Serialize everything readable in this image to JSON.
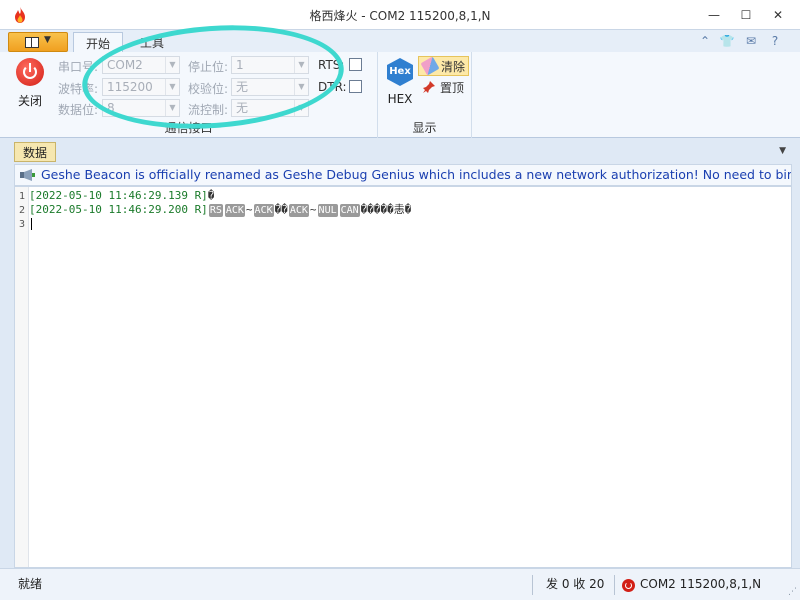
{
  "window": {
    "title": "格西烽火 - COM2  115200,8,1,N",
    "minimize": "—",
    "maximize": "☐",
    "close": "✕"
  },
  "ribbon": {
    "tabs": [
      {
        "label": "开始",
        "active": true
      },
      {
        "label": "工具",
        "active": false
      }
    ],
    "close_button": "关闭",
    "comm": {
      "port_label": "串口号:",
      "port_value": "COM2",
      "baud_label": "波特率:",
      "baud_value": "115200",
      "databits_label": "数据位:",
      "databits_value": "8",
      "stopbits_label": "停止位:",
      "stopbits_value": "1",
      "parity_label": "校验位:",
      "parity_value": "无",
      "flow_label": "流控制:",
      "flow_value": "无",
      "rts_label": "RTS:",
      "dtr_label": "DTR:",
      "group_label": "通信接口"
    },
    "display": {
      "hex_label": "HEX",
      "hex_icon_text": "Hex",
      "clear_label": "清除",
      "top_label": "置顶",
      "group_label": "显示"
    }
  },
  "document": {
    "tab_label": "数据",
    "notice": "Geshe Beacon is officially renamed as Geshe Debug Genius which includes a new network authorization! No need to bind comput",
    "lines": [
      {
        "num": "1",
        "timestamp": "[2022-05-10 11:46:29.139 R]",
        "bytes": [
          {
            "t": "text",
            "v": "�"
          }
        ]
      },
      {
        "num": "2",
        "timestamp": "[2022-05-10 11:46:29.200 R]",
        "bytes": [
          {
            "t": "ctl",
            "v": "RS"
          },
          {
            "t": "ctl",
            "v": "ACK"
          },
          {
            "t": "text",
            "v": "~"
          },
          {
            "t": "ctl",
            "v": "ACK"
          },
          {
            "t": "text",
            "v": "��"
          },
          {
            "t": "ctl",
            "v": "ACK"
          },
          {
            "t": "text",
            "v": "~"
          },
          {
            "t": "ctl",
            "v": "NUL"
          },
          {
            "t": "ctl",
            "v": "CAN"
          },
          {
            "t": "text",
            "v": "�����恚�"
          }
        ]
      },
      {
        "num": "3",
        "timestamp": "",
        "bytes": []
      }
    ]
  },
  "status": {
    "ready": "就绪",
    "counts": "发 0  收 20",
    "port": "COM2  115200,8,1,N"
  },
  "colors": {
    "annotation": "#3ed8cf",
    "timestamp": "#1a7a2a",
    "notice_text": "#1a3fb0"
  }
}
